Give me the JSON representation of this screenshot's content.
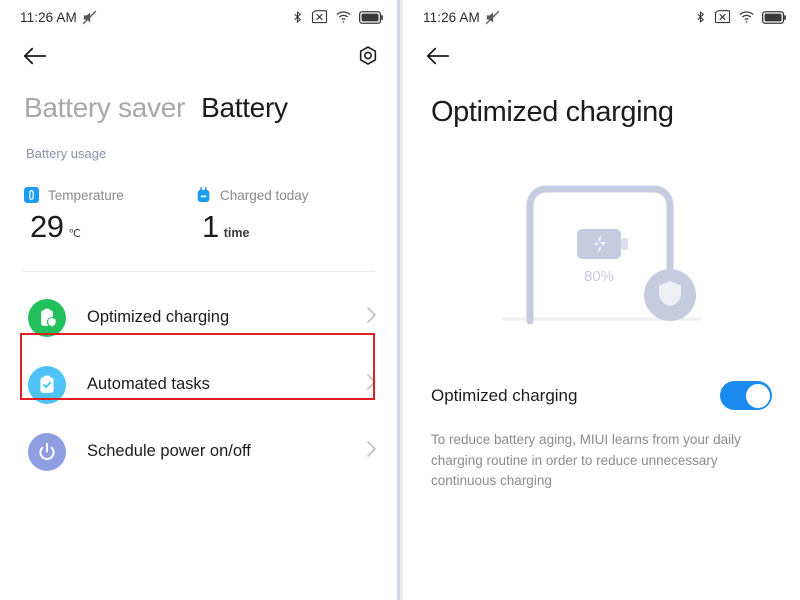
{
  "colors": {
    "accent_blue": "#1a8cf0",
    "toggle_on": "#1a8cf0",
    "green": "#22c15e",
    "light_blue": "#4fc3f7",
    "periwinkle": "#8e9ee0",
    "highlight_red": "#e02020",
    "illustration": "#c7cbe0",
    "muted_text": "#8c8c8c",
    "link_text": "#8791a8"
  },
  "status_bar": {
    "time": "11:26 AM",
    "icons": [
      "mute-icon",
      "bluetooth-icon",
      "no-sim-icon",
      "wifi-icon",
      "battery-icon"
    ]
  },
  "left_panel": {
    "nav": {
      "back_icon": "back-arrow-icon",
      "settings_icon": "gear-icon"
    },
    "tabs": [
      {
        "label": "Battery saver",
        "active": false
      },
      {
        "label": "Battery",
        "active": true
      }
    ],
    "battery_usage_link": "Battery usage",
    "stats": [
      {
        "icon": "thermometer-icon",
        "label": "Temperature",
        "value": "29",
        "unit": "℃"
      },
      {
        "icon": "charger-plug-icon",
        "label": "Charged today",
        "value": "1",
        "unit": "time"
      }
    ],
    "list_items": [
      {
        "label": "Optimized charging",
        "icon": "battery-shield-icon",
        "color": "#22c15e",
        "highlighted": true
      },
      {
        "label": "Automated tasks",
        "icon": "clipboard-check-icon",
        "color": "#4fc3f7",
        "highlighted": false
      },
      {
        "label": "Schedule power on/off",
        "icon": "power-icon",
        "color": "#8e9ee0",
        "highlighted": false
      }
    ],
    "chevron": "chevron-right-icon"
  },
  "right_panel": {
    "nav": {
      "back_icon": "back-arrow-icon"
    },
    "title": "Optimized charging",
    "illustration": {
      "name": "charging-cable-illustration",
      "battery_icon": "battery-bolt-icon",
      "percent_label": "80%",
      "shield_icon": "shield-icon"
    },
    "toggle": {
      "label": "Optimized charging",
      "state": "on",
      "name": "optimized-charging-toggle"
    },
    "description": "To reduce battery aging, MIUI learns from your daily charging routine in order to reduce unnecessary continuous charging"
  }
}
